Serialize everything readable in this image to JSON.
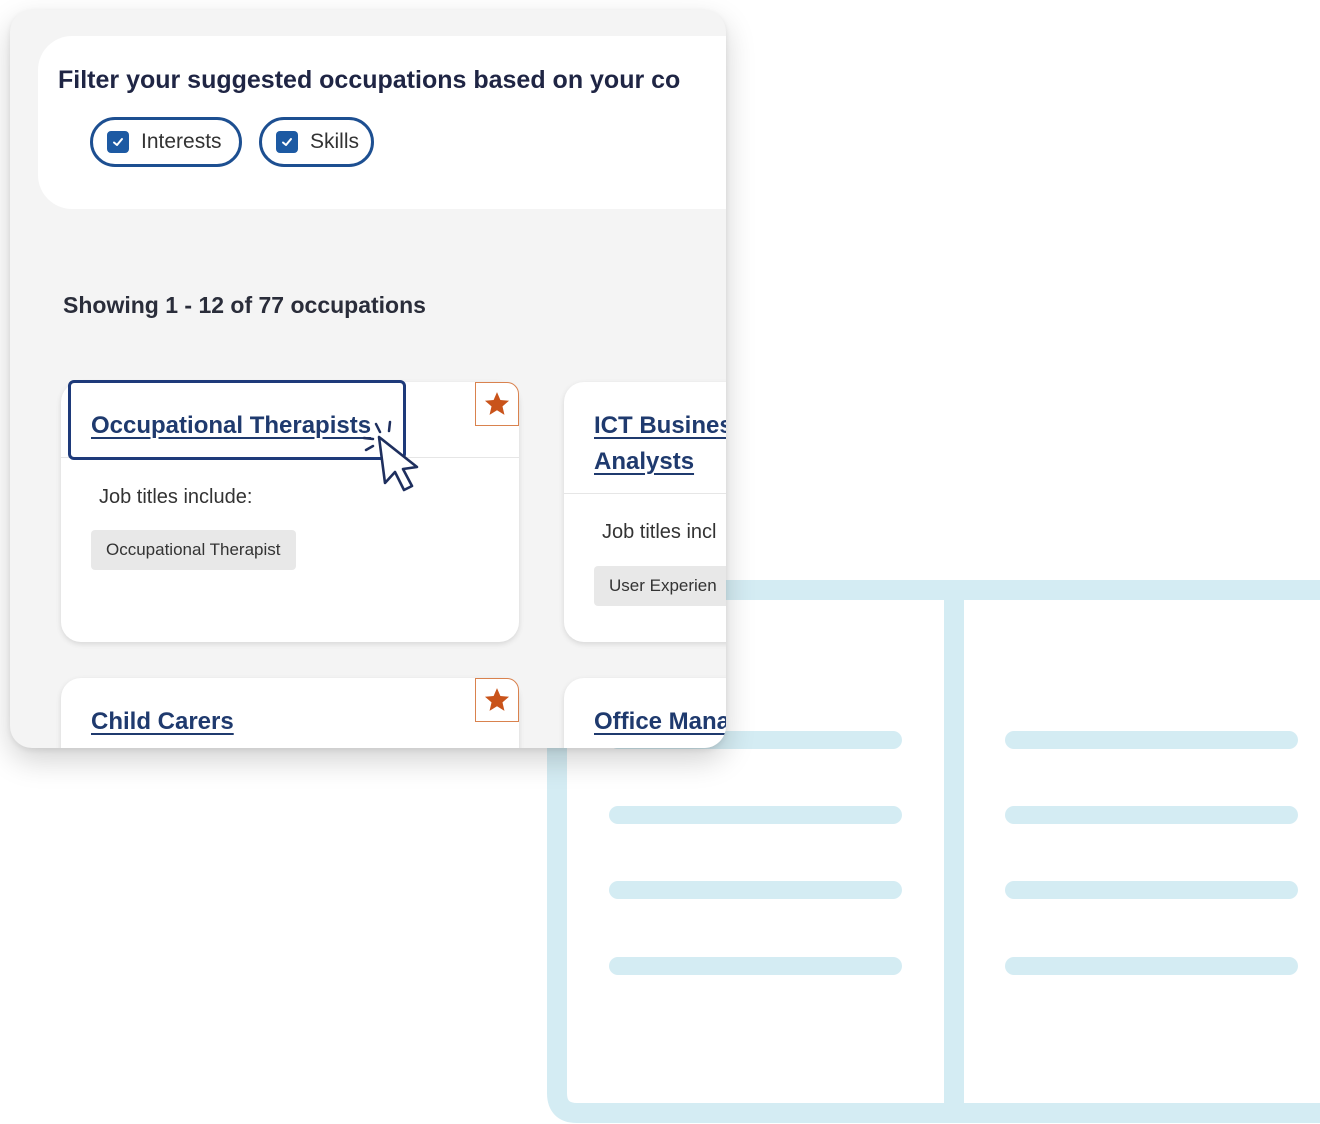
{
  "filter": {
    "title": "Filter your suggested occupations based on your co",
    "chips": [
      {
        "label": "Interests",
        "checked": true
      },
      {
        "label": "Skills",
        "checked": true
      }
    ]
  },
  "results": {
    "summary": "Showing 1 - 12 of 77 occupations"
  },
  "cards": [
    {
      "title": "Occupational Therapists",
      "job_titles_label": "Job titles include:",
      "tag": "Occupational Therapist",
      "starred": true
    },
    {
      "title_line1": "ICT Busines",
      "title_line2": "Analysts",
      "job_titles_label": "Job titles incl",
      "tag": "User Experien"
    },
    {
      "title": "Child Carers",
      "starred": true
    },
    {
      "title": "Office Mana"
    }
  ],
  "colors": {
    "accent_blue": "#1d4f91",
    "title_blue": "#1f3a6e",
    "star_orange": "#c9531a",
    "decor_light_blue": "#d4ecf3"
  },
  "icons": [
    "checkbox-checked-icon",
    "star-icon",
    "pointer-cursor-icon"
  ]
}
